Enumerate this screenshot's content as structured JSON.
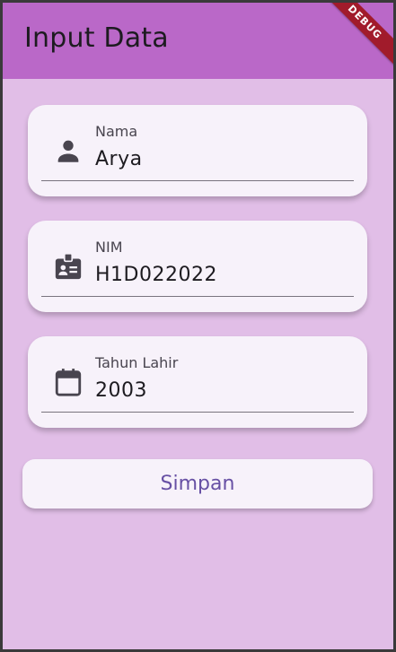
{
  "app_bar": {
    "title": "Input Data",
    "debug_banner": "DEBUG",
    "color": "#ba68c8"
  },
  "form": {
    "fields": [
      {
        "label": "Nama",
        "value": "Arya",
        "icon": "person-icon"
      },
      {
        "label": "NIM",
        "value": "H1D022022",
        "icon": "badge-icon"
      },
      {
        "label": "Tahun Lahir",
        "value": "2003",
        "icon": "calendar-icon"
      }
    ],
    "submit_label": "Simpan"
  },
  "colors": {
    "background": "#e1bee7",
    "card": "#f7f2fa",
    "button_text": "#6750a4"
  }
}
